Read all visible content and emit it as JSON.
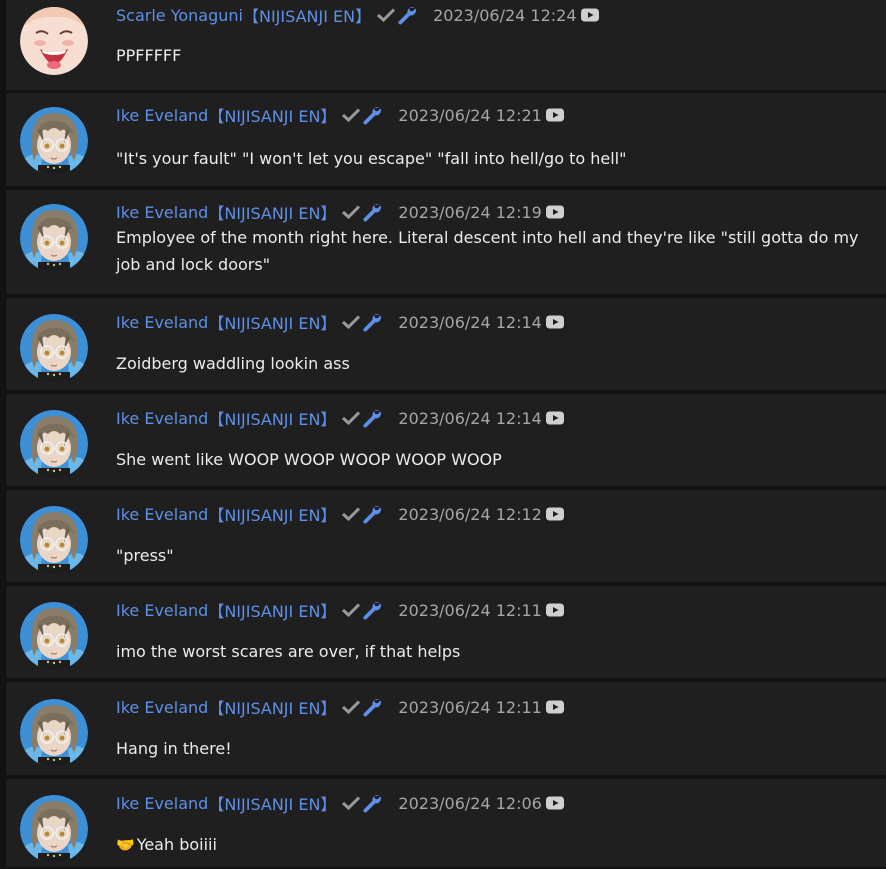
{
  "messages": [
    {
      "author": "Scarle Yonaguni",
      "tag": "【NIJISANJI EN】",
      "timestamp": "2023/06/24 12:24",
      "text": "PPFFFFF",
      "avatar": "scarle-avatar",
      "verified_icon": "check-icon",
      "moderator_icon": "wrench-icon",
      "source_icon": "youtube-icon"
    },
    {
      "author": "Ike Eveland",
      "tag": "【NIJISANJI EN】",
      "timestamp": "2023/06/24 12:21",
      "text": "\"It's your fault\" \"I won't let you escape\" \"fall into hell/go to hell\"",
      "avatar": "ike-avatar",
      "verified_icon": "check-icon",
      "moderator_icon": "wrench-icon",
      "source_icon": "youtube-icon"
    },
    {
      "author": "Ike Eveland",
      "tag": "【NIJISANJI EN】",
      "timestamp": "2023/06/24 12:19",
      "text": "Employee of the month right here. Literal descent into hell and they're like \"still gotta do my job and lock doors\"",
      "avatar": "ike-avatar",
      "verified_icon": "check-icon",
      "moderator_icon": "wrench-icon",
      "source_icon": "youtube-icon"
    },
    {
      "author": "Ike Eveland",
      "tag": "【NIJISANJI EN】",
      "timestamp": "2023/06/24 12:14",
      "text": "Zoidberg waddling lookin ass",
      "avatar": "ike-avatar",
      "verified_icon": "check-icon",
      "moderator_icon": "wrench-icon",
      "source_icon": "youtube-icon"
    },
    {
      "author": "Ike Eveland",
      "tag": "【NIJISANJI EN】",
      "timestamp": "2023/06/24 12:14",
      "text": "She went like WOOP WOOP WOOP WOOP WOOP",
      "avatar": "ike-avatar",
      "verified_icon": "check-icon",
      "moderator_icon": "wrench-icon",
      "source_icon": "youtube-icon"
    },
    {
      "author": "Ike Eveland",
      "tag": "【NIJISANJI EN】",
      "timestamp": "2023/06/24 12:12",
      "text": "\"press\"",
      "avatar": "ike-avatar",
      "verified_icon": "check-icon",
      "moderator_icon": "wrench-icon",
      "source_icon": "youtube-icon"
    },
    {
      "author": "Ike Eveland",
      "tag": "【NIJISANJI EN】",
      "timestamp": "2023/06/24 12:11",
      "text": "imo the worst scares are over, if that helps",
      "avatar": "ike-avatar",
      "verified_icon": "check-icon",
      "moderator_icon": "wrench-icon",
      "source_icon": "youtube-icon"
    },
    {
      "author": "Ike Eveland",
      "tag": "【NIJISANJI EN】",
      "timestamp": "2023/06/24 12:11",
      "text": "Hang in there!",
      "avatar": "ike-avatar",
      "verified_icon": "check-icon",
      "moderator_icon": "wrench-icon",
      "source_icon": "youtube-icon"
    },
    {
      "author": "Ike Eveland",
      "tag": "【NIJISANJI EN】",
      "timestamp": "2023/06/24 12:06",
      "text": "Yeah boiiii",
      "emoji": "🤝",
      "avatar": "ike-avatar",
      "verified_icon": "check-icon",
      "moderator_icon": "wrench-icon",
      "source_icon": "youtube-icon"
    }
  ],
  "colors": {
    "background": "#121212",
    "row": "#1f1f1f",
    "author": "#5f8fe6",
    "timestamp": "#a6a6a6",
    "text": "#ececec",
    "check": "#9a9a9a",
    "wrench": "#5f8fe6"
  }
}
